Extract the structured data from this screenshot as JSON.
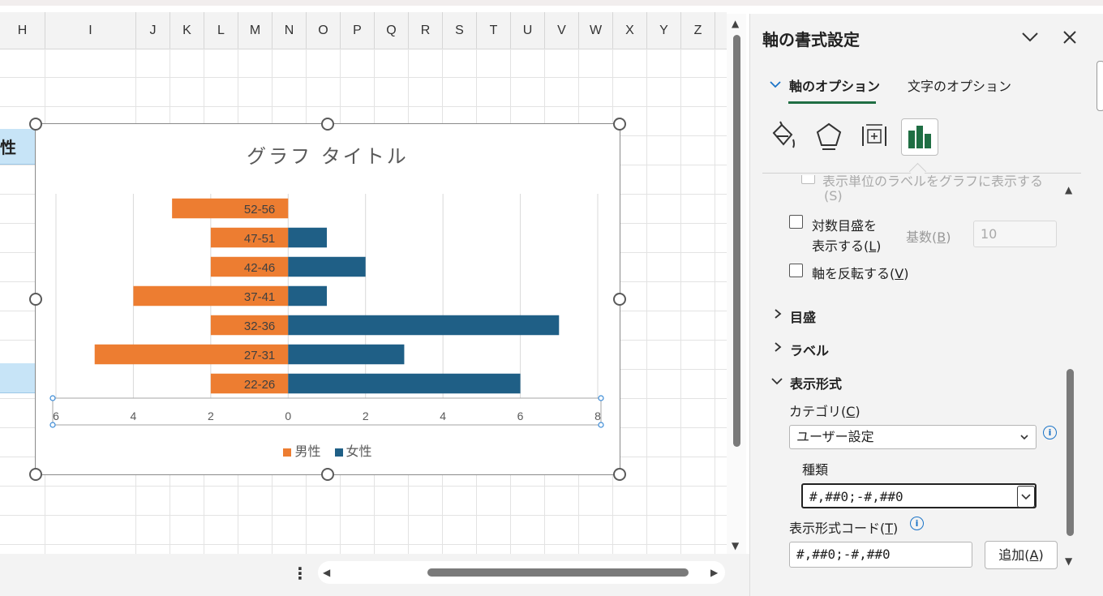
{
  "sheet": {
    "columns": [
      "H",
      "I",
      "J",
      "K",
      "L",
      "M",
      "N",
      "O",
      "P",
      "Q",
      "R",
      "S",
      "T",
      "U",
      "V",
      "W",
      "X",
      "Y",
      "Z"
    ],
    "cell_a_text": "性"
  },
  "chart": {
    "title": "グラフ タイトル",
    "legend": [
      {
        "name": "男性",
        "color": "#ed7d31"
      },
      {
        "name": "女性",
        "color": "#1f5f86"
      }
    ]
  },
  "chart_data": {
    "type": "bar",
    "orientation": "horizontal",
    "title": "グラフ タイトル",
    "categories": [
      "52-56",
      "47-51",
      "42-46",
      "37-41",
      "32-36",
      "27-31",
      "22-26"
    ],
    "series": [
      {
        "name": "男性",
        "values": [
          -3,
          -2,
          -2,
          -4,
          -2,
          -5,
          -2
        ],
        "color": "#ed7d31"
      },
      {
        "name": "女性",
        "values": [
          0,
          1,
          2,
          1,
          7,
          3,
          6
        ],
        "color": "#1f5f86"
      }
    ],
    "x_ticks": [
      "6",
      "4",
      "2",
      "0",
      "2",
      "4",
      "6",
      "8"
    ],
    "xlim": [
      -6,
      8
    ],
    "grid": true,
    "legend_position": "bottom"
  },
  "pane": {
    "title": "軸の書式設定",
    "tabs": {
      "axis_options": "軸のオプション",
      "text_options": "文字のオプション"
    },
    "faded_line1": "表示単位のラベルをグラフに表示する",
    "faded_line2": "(S)",
    "log_scale_label1": "対数目盛を",
    "log_scale_label2": "表示する(",
    "log_scale_key": "L",
    "base_label": "基数(",
    "base_key": "B",
    "base_value": "10",
    "reverse_label": "軸を反転する(",
    "reverse_key": "V",
    "section_ticks": "目盛",
    "section_labels": "ラベル",
    "section_number": "表示形式",
    "category_label": "カテゴリ(",
    "category_key": "C",
    "category_value": "ユーザー設定",
    "type_label": "種類",
    "type_value": "#,##0;-#,##0",
    "code_label": "表示形式コード(",
    "code_key": "T",
    "code_value": "#,##0;-#,##0",
    "add_button": "追加(",
    "add_key": "A"
  }
}
